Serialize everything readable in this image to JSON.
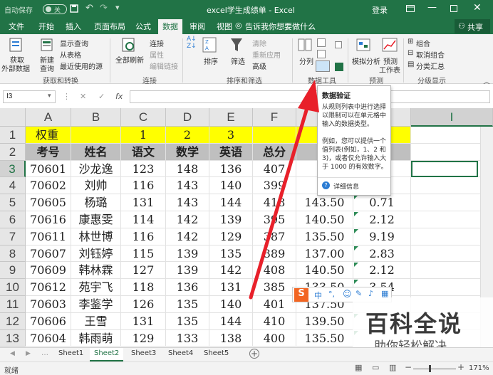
{
  "title_bar": {
    "autosave_label": "自动保存",
    "autosave_state": "关",
    "file_title": "excel学生成绩单 - Excel",
    "login_label": "登录"
  },
  "tabs": [
    "文件",
    "开始",
    "插入",
    "页面布局",
    "公式",
    "数据",
    "审阅",
    "视图"
  ],
  "active_tab": "数据",
  "tell_me": "告诉我你想要做什么",
  "share_label": "共享",
  "ribbon": {
    "get_external": "获取",
    "get_external2": "外部数据",
    "new_query": "新建",
    "new_query2": "查询",
    "show_queries": "显示查询",
    "from_table": "从表格",
    "recent_sources": "最近使用的源",
    "refresh_all": "全部刷新",
    "connections": "连接",
    "properties": "属性",
    "edit_links": "编辑链接",
    "sort": "排序",
    "filter": "筛选",
    "clear": "清除",
    "reapply": "重新应用",
    "advanced": "高级",
    "text_to_columns": "分列",
    "what_if": "模拟分析",
    "forecast_sheet": "预测",
    "forecast_sheet2": "工作表",
    "group": "组合",
    "ungroup": "取消组合",
    "subtotal": "分类汇总",
    "groups": [
      "获取和转换",
      "连接",
      "排序和筛选",
      "数据工具",
      "预测",
      "分级显示"
    ]
  },
  "name_box": "I3",
  "tooltip": {
    "title": "数据验证",
    "body1": [
      "从规则列表中进行选择",
      "以限制可以在单元格中",
      "输入的数据类型。"
    ],
    "body2": [
      "例如，您可以提供一个",
      "值列表(例如，1、2 和",
      "3)，或者仅允许输入大",
      "于 1000 的有效数字。"
    ],
    "more_info": "详细信息"
  },
  "columns": [
    "A",
    "B",
    "C",
    "D",
    "E",
    "F",
    "G",
    "H",
    "I"
  ],
  "rows": [
    [
      "权重",
      "",
      "1",
      "2",
      "3",
      "",
      "",
      "分",
      ""
    ],
    [
      "考号",
      "姓名",
      "语文",
      "数学",
      "英语",
      "总分",
      "平",
      "差",
      ""
    ],
    [
      "70601",
      "沙龙逸",
      "123",
      "148",
      "136",
      "407",
      "14",
      "",
      ""
    ],
    [
      "70602",
      "刘帅",
      "116",
      "143",
      "140",
      "399",
      "14",
      "",
      ""
    ],
    [
      "70605",
      "杨璐",
      "131",
      "143",
      "144",
      "418",
      "143.50",
      "0.71",
      ""
    ],
    [
      "70616",
      "康惠雯",
      "114",
      "142",
      "139",
      "395",
      "140.50",
      "2.12",
      ""
    ],
    [
      "70611",
      "林世博",
      "116",
      "142",
      "129",
      "387",
      "135.50",
      "9.19",
      ""
    ],
    [
      "70607",
      "刘钰婷",
      "115",
      "139",
      "135",
      "389",
      "137.00",
      "2.83",
      ""
    ],
    [
      "70609",
      "韩林霖",
      "127",
      "139",
      "142",
      "408",
      "140.50",
      "2.12",
      ""
    ],
    [
      "70612",
      "苑宇飞",
      "118",
      "136",
      "131",
      "385",
      "133.50",
      "3.54",
      ""
    ],
    [
      "70603",
      "李鉴学",
      "126",
      "135",
      "140",
      "401",
      "137.50",
      "",
      ""
    ],
    [
      "70606",
      "王雪",
      "131",
      "135",
      "144",
      "410",
      "139.50",
      "",
      ""
    ],
    [
      "70604",
      "韩雨萌",
      "129",
      "133",
      "138",
      "400",
      "135.50",
      "",
      ""
    ]
  ],
  "sheets": [
    "Sheet1",
    "Sheet2",
    "Sheet3",
    "Sheet4",
    "Sheet5"
  ],
  "active_sheet": "Sheet2",
  "status": "就绪",
  "zoom": "171%",
  "watermark": {
    "title": "百科全说",
    "subtitle": "助你轻松解决"
  },
  "colors": {
    "excel_green": "#217346",
    "weight_row": "#ffff00",
    "header_row": "#bfbfbf",
    "arrow": "#e8202a"
  }
}
